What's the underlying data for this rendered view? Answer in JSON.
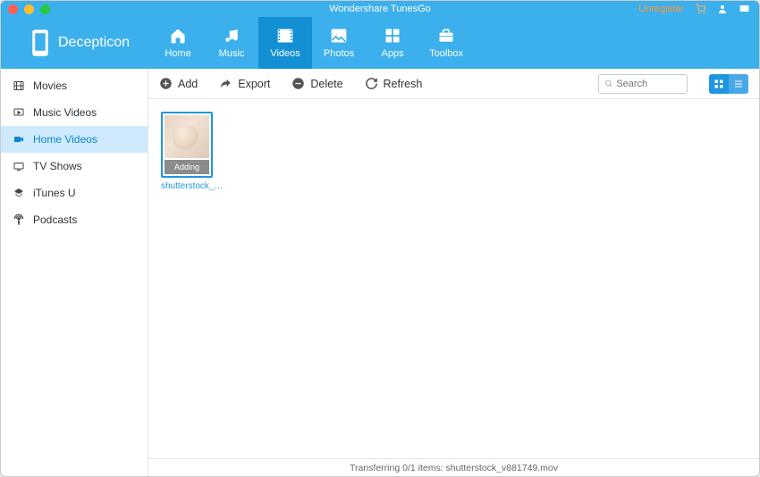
{
  "app": {
    "title": "Wondershare TunesGo",
    "unregister": "Unregister"
  },
  "device": {
    "name": "Decepticon"
  },
  "nav": {
    "home": "Home",
    "music": "Music",
    "videos": "Videos",
    "photos": "Photos",
    "apps": "Apps",
    "toolbox": "Toolbox"
  },
  "sidebar": {
    "movies": "Movies",
    "music_videos": "Music Videos",
    "home_videos": "Home Videos",
    "tv_shows": "TV Shows",
    "itunes_u": "iTunes U",
    "podcasts": "Podcasts"
  },
  "toolbar": {
    "add": "Add",
    "export": "Export",
    "delete": "Delete",
    "refresh": "Refresh",
    "search_placeholder": "Search"
  },
  "content": {
    "video1": {
      "status": "Adding",
      "label": "shutterstock_v..."
    }
  },
  "statusbar": {
    "text": "Transferring 0/1 items: shutterstock_v881749.mov"
  }
}
